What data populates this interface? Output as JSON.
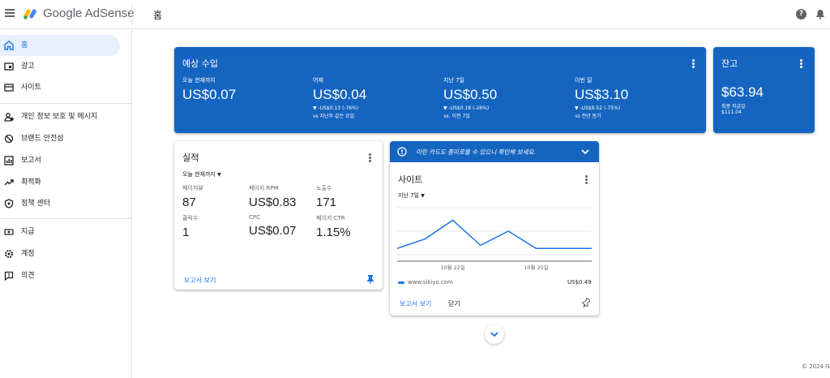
{
  "header": {
    "brand": "Google AdSense",
    "crumb": "홈"
  },
  "sidebar": {
    "items": [
      {
        "label": "홈"
      },
      {
        "label": "광고"
      },
      {
        "label": "사이트"
      },
      {
        "label": "개인 정보 보호 및 메시지"
      },
      {
        "label": "브랜드 안전성"
      },
      {
        "label": "보고서"
      },
      {
        "label": "최적화"
      },
      {
        "label": "정책 센터"
      },
      {
        "label": "지급"
      },
      {
        "label": "계정"
      },
      {
        "label": "의견"
      }
    ]
  },
  "earnings": {
    "title": "예상 수입",
    "items": [
      {
        "label": "오늘 현재까지",
        "value": "US$0.07",
        "delta": "",
        "compare": ""
      },
      {
        "label": "어제",
        "value": "US$0.04",
        "delta": "▼ -US$0.13 (-76%)",
        "compare": "vs 지난주 같은 요일"
      },
      {
        "label": "지난 7일",
        "value": "US$0.50",
        "delta": "▼ -US$0.18 (-26%)",
        "compare": "vs. 이전 7일"
      },
      {
        "label": "이번 달",
        "value": "US$3.10",
        "delta": "▼ -US$9.52 (-75%)",
        "compare": "vs 전년 동기"
      }
    ]
  },
  "balance": {
    "title": "잔고",
    "value": "$63.94",
    "last_label": "최종 지급일",
    "last_value": "$111.04"
  },
  "performance": {
    "title": "실적",
    "period": "오늘 현재까지",
    "metrics": [
      {
        "label": "페이지뷰",
        "value": "87"
      },
      {
        "label": "페이지 RPM",
        "value": "US$0.83"
      },
      {
        "label": "노출수",
        "value": "171"
      },
      {
        "label": "클릭수",
        "value": "1"
      },
      {
        "label": "CPC",
        "value": "US$0.07"
      },
      {
        "label": "페이지 CTR",
        "value": "1.15%"
      }
    ],
    "report_link": "보고서 보기"
  },
  "sites": {
    "banner": "이런 카드도 흥미로울 수 있으니 확인해 보세요.",
    "title": "사이트",
    "period": "지난 7일",
    "x_ticks": [
      "10월 22일",
      "10월 25일"
    ],
    "site_name": "www.sikiyo.com",
    "site_value": "US$0.49",
    "report_link": "보고서 보기",
    "close_label": "닫기"
  },
  "chart_data": {
    "type": "line",
    "x": [
      "10월 20일",
      "10월 21일",
      "10월 22일",
      "10월 23일",
      "10월 24일",
      "10월 25일",
      "10월 26일",
      "10월 27일"
    ],
    "series": [
      {
        "values": [
          0.04,
          0.1,
          0.22,
          0.06,
          0.15,
          0.04,
          0.04,
          0.04
        ]
      }
    ],
    "ylim": [
      0,
      0.3
    ],
    "grid": true,
    "color": "#1a73e8"
  },
  "footer": {
    "copyright": "© 2024 G"
  },
  "colors": {
    "accent": "#1565c0",
    "link": "#1a73e8"
  }
}
